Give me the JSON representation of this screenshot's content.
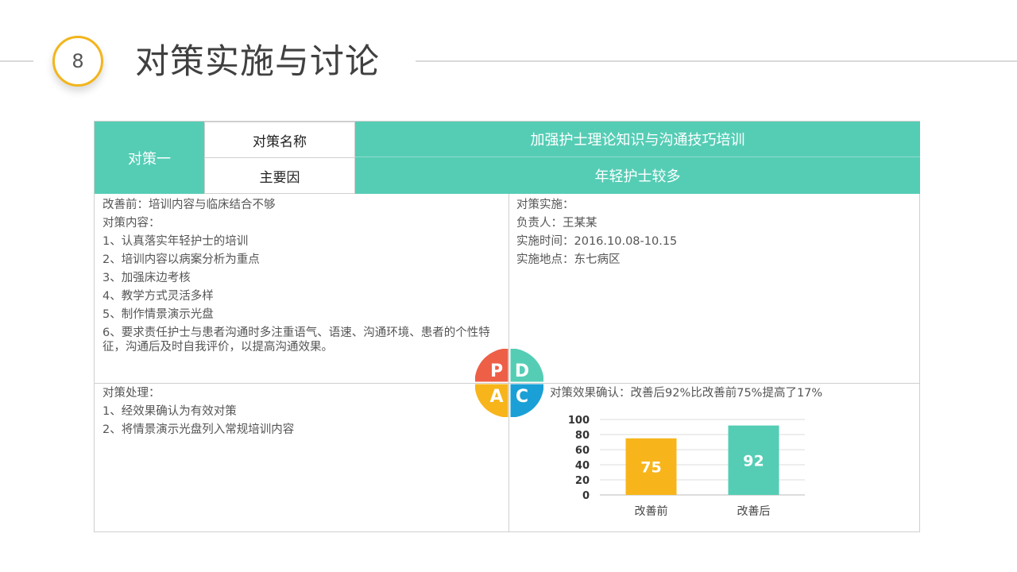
{
  "header": {
    "badge_number": "8",
    "title": "对策实施与讨论"
  },
  "table": {
    "row_label": "对策一",
    "name_label": "对策名称",
    "name_value": "加强护士理论知识与沟通技巧培训",
    "cause_label": "主要因",
    "cause_value": "年轻护士较多"
  },
  "plan": {
    "lines": [
      "改善前：培训内容与临床结合不够",
      "对策内容：",
      "1、认真落实年轻护士的培训",
      "2、培训内容以病案分析为重点",
      "3、加强床边考核",
      "4、教学方式灵活多样",
      "5、制作情景演示光盘"
    ],
    "line_6": "6、要求责任护士与患者沟通时多注重语气、语速、沟通环境、患者的个性特征，沟通后及时自我评价，以提高沟通效果。"
  },
  "do": {
    "lines": [
      "对策实施：",
      "负责人：王某某",
      "实施时间：2016.10.08-10.15",
      "实施地点：东七病区"
    ]
  },
  "act": {
    "lines": [
      "对策处理：",
      "1、经效果确认为有效对策",
      "2、将情景演示光盘列入常规培训内容"
    ]
  },
  "check": {
    "heading": "对策效果确认：改善后92%比改善前75%提高了17%"
  },
  "pdca": {
    "letters": [
      "P",
      "D",
      "A",
      "C"
    ],
    "colors": {
      "P": "#ee5f47",
      "D": "#55cdb5",
      "A": "#f7b51b",
      "C": "#1aa0d6"
    }
  },
  "colors": {
    "teal": "#55cdb5",
    "yellow": "#f7b51b",
    "badge_ring": "#f2b51c"
  },
  "chart_data": {
    "type": "bar",
    "categories": [
      "改善前",
      "改善后"
    ],
    "values": [
      75,
      92
    ],
    "colors": [
      "#f7b51b",
      "#55cdb5"
    ],
    "yticks": [
      0,
      20,
      40,
      60,
      80,
      100
    ],
    "ylim": [
      0,
      100
    ],
    "title": "",
    "xlabel": "",
    "ylabel": ""
  }
}
